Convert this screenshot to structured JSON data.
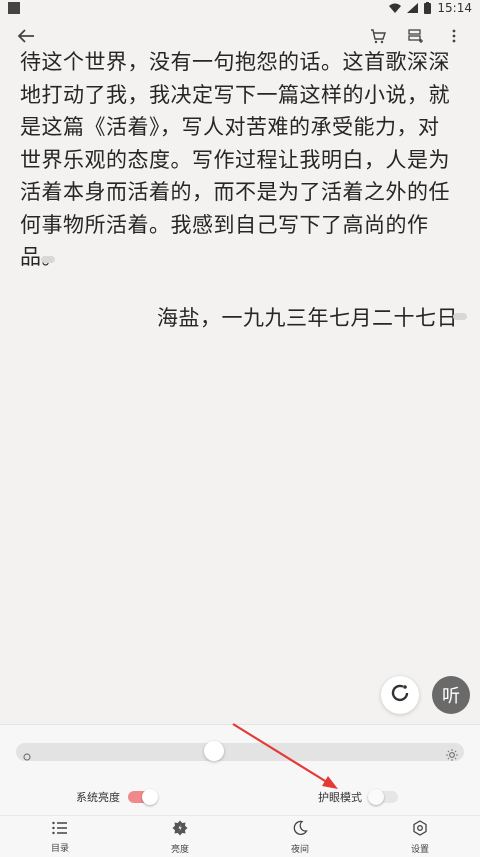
{
  "status_bar": {
    "time": "15:14"
  },
  "top_bar": {
    "back_icon": "arrow-left-icon",
    "actions": [
      "cart-icon",
      "bookmark-add-icon",
      "more-vert-icon"
    ]
  },
  "content": {
    "lines": [
      "待这个世界，没有一句抱怨的话。这首歌深深",
      "地打动了我，我决定写下一篇这样的小说，就",
      "是这篇《活着》，写人对苦难的承受能力，对",
      "世界乐观的态度。写作过程让我明白，人是为",
      "活着本身而活着的，而不是为了活着之外的任",
      "何事物所活着。我感到自己写下了高尚的作",
      "品。"
    ],
    "signature": "海盐，一九九三年七月二十七日"
  },
  "fabs": {
    "refresh_icon": "refresh-icon",
    "listen_label": "听"
  },
  "panel": {
    "brightness_level": 0.44,
    "system_brightness_label": "系统亮度",
    "system_brightness_on": true,
    "eye_mode_label": "护眼模式",
    "eye_mode_on": false,
    "tabs": [
      {
        "label": "目录",
        "icon": "list-icon"
      },
      {
        "label": "亮度",
        "icon": "brightness-icon"
      },
      {
        "label": "夜间",
        "icon": "moon-icon"
      },
      {
        "label": "设置",
        "icon": "settings-icon"
      }
    ]
  },
  "colors": {
    "background": "#f3f2f0",
    "toggle_on": "#f08a8a",
    "arrow": "#e53935"
  }
}
